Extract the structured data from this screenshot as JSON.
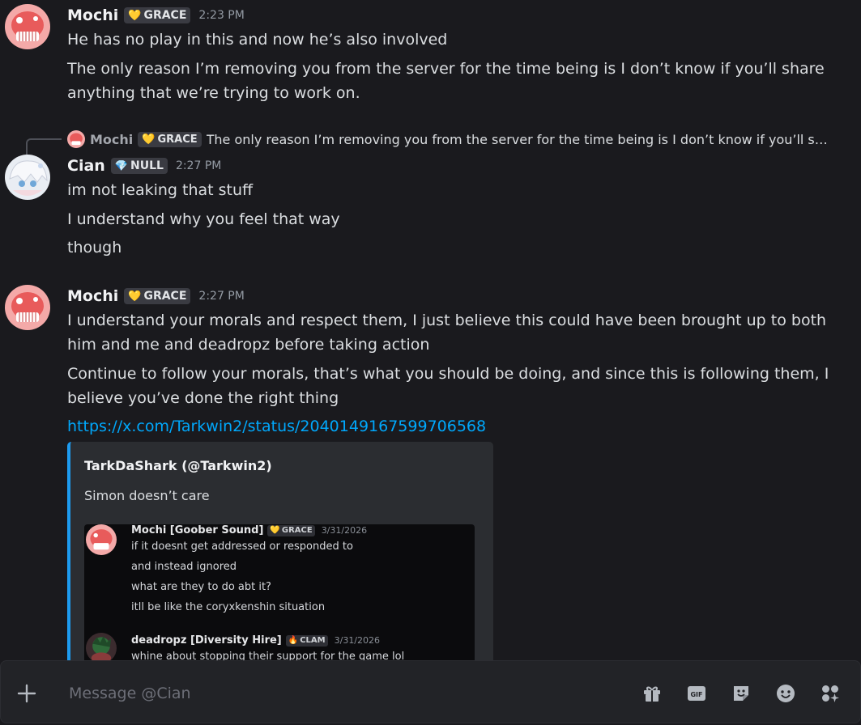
{
  "messages": [
    {
      "author": "Mochi",
      "badge": {
        "icon": "yellow-heart",
        "text": "GRACE"
      },
      "time": "2:23 PM",
      "lines": [
        "He has no play in this and now he’s also involved",
        "The only reason I’m removing you from the server for the time being is I don’t know if you’ll share",
        "anything that we’re trying to work on."
      ]
    },
    {
      "reply": {
        "author": "Mochi",
        "badge": {
          "icon": "yellow-heart",
          "text": "GRACE"
        },
        "text": "The only reason I’m removing you from the server for the time being is I don’t know if you’ll s…"
      },
      "author": "Cian",
      "badge": {
        "icon": "purple-gem",
        "text": "NULL"
      },
      "time": "2:27 PM",
      "lines": [
        "im not leaking that stuff",
        "I understand why you feel that way",
        "though"
      ]
    },
    {
      "author": "Mochi",
      "badge": {
        "icon": "yellow-heart",
        "text": "GRACE"
      },
      "time": "2:27 PM",
      "lines": [
        "I understand your morals and respect them, I just believe this could have been brought up to both",
        "him and me and deadropz before taking action",
        "Continue to follow your morals, that’s what you should be doing, and since this is following them, I",
        "believe you’ve done the right thing"
      ],
      "link": "https://x.com/Tarkwin2/status/2040149167599706568",
      "embed": {
        "author": "TarkDaShark (@Tarkwin2)",
        "description": "Simon doesn’t care",
        "image": {
          "messages": [
            {
              "author": "Mochi [Goober Sound]",
              "badge": {
                "icon": "yellow-heart",
                "text": "GRACE"
              },
              "date": "3/31/2026",
              "lines": [
                "if it doesnt get addressed or responded to",
                "and instead ignored",
                "what are they to do abt it?",
                "itll be like the coryxkenshin situation"
              ]
            },
            {
              "author": "deadropz [Diversity Hire]",
              "badge": {
                "icon": "fire",
                "text": "CLAM"
              },
              "date": "3/31/2026",
              "lines": [
                "whine about stopping their support for the game lol"
              ]
            }
          ]
        }
      }
    }
  ],
  "composer": {
    "placeholder": "Message @Cian",
    "gif_label": "GIF",
    "tools": [
      "gift-icon",
      "gif-icon",
      "sticker-icon",
      "emoji-icon",
      "apps-icon"
    ]
  },
  "colors": {
    "background": "#1a1a1e",
    "link": "#00a8fc",
    "embed_accent": "#1d9bf0",
    "text": "#dbdee1"
  }
}
